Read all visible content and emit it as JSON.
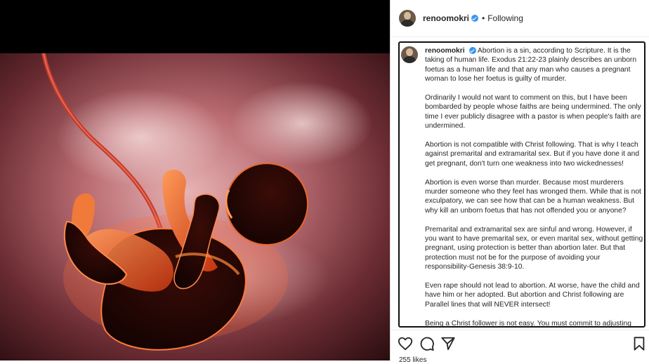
{
  "post": {
    "username": "renoomokri",
    "follow_status": "Following",
    "separator": "•",
    "image_alt": "illustration of an unborn foetus with umbilical cord",
    "caption_paragraphs": [
      "Abortion is a sin, according to Scripture. It is the taking of human life. Exodus 21:22-23 plainly describes an unborn foetus as a human life and that any man who causes a pregnant woman to lose her foetus is guilty of murder.",
      "Ordinarily I would not want to comment on this, but I have been bombarded by people whose faiths are being undermined. The only time I ever publicly disagree with a pastor is when people's faith are undermined.",
      "Abortion is not compatible with Christ following. That is why I teach against premarital and extramarital sex. But if you have done it and get pregnant, don't turn one weakness into two wickednesses!",
      "Abortion is even worse than murder. Because most murderers murder someone who they feel has wronged them. While that is not exculpatory, we can see how that can be a human weakness. But why kill an unborn foetus that has not offended you or anyone?",
      "Premarital and extramarital sex are sinful and wrong. However, if you want to have premarital sex, or even marital sex, without getting pregnant, using protection is better than abortion later. But that protection must not be for the purpose of avoiding your responsibility-Genesis 38:9-10.",
      "Even rape should not lead to abortion. At worse, have the child and have him or her adopted. But abortion and Christ following are Parallel lines that will NEVER intersect!",
      "Being a Christ follower is not easy. You must commit to adjusting"
    ],
    "likes_text": "255 likes"
  },
  "icons": {
    "like": "heart-icon",
    "comment": "comment-icon",
    "share": "share-icon",
    "save": "bookmark-icon"
  },
  "colors": {
    "verified": "#3897f0",
    "text": "#262626"
  }
}
